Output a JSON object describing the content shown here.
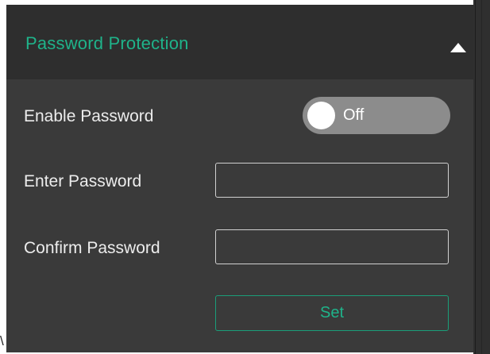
{
  "panel": {
    "title": "Password Protection",
    "collapse_icon": "triangle-up-icon",
    "colors": {
      "background": "#3a3a3a",
      "header_background": "#2e2e2e",
      "accent": "#1fb38a"
    }
  },
  "enable_password": {
    "label": "Enable Password",
    "toggle_state_label": "Off",
    "enabled": false
  },
  "enter_password": {
    "label": "Enter Password",
    "value": ""
  },
  "confirm_password": {
    "label": "Confirm Password",
    "value": ""
  },
  "set_button": {
    "label": "Set"
  },
  "stray_glyph": "\\"
}
